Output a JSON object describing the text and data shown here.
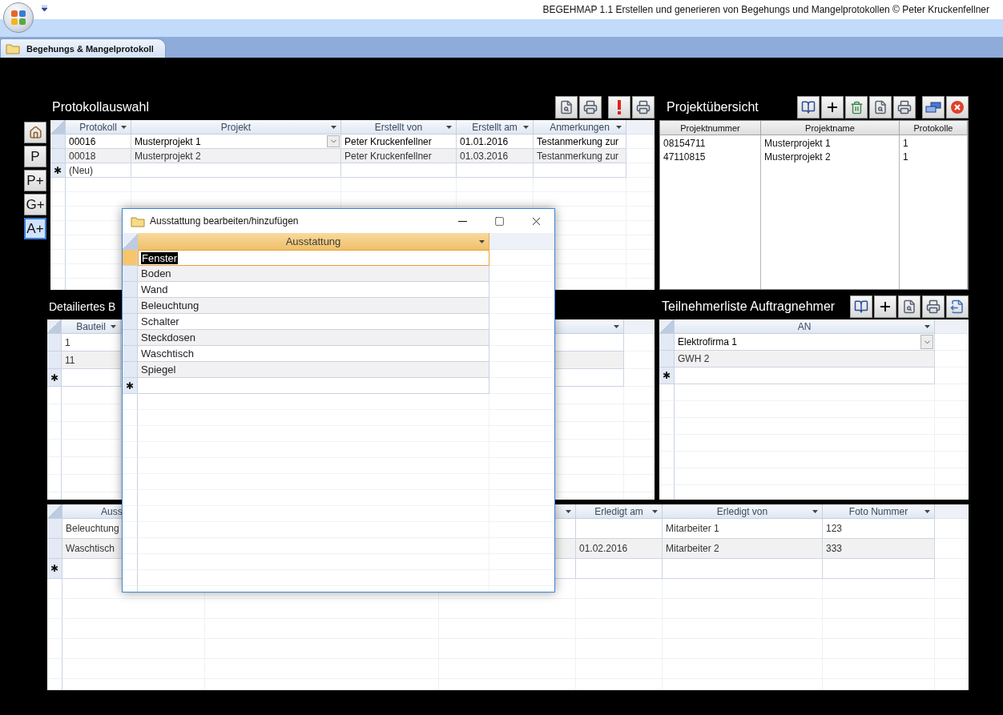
{
  "app": {
    "title": "BEGEHMAP 1.1 Erstellen und generieren von Begehungs und Mangelprotokollen © Peter Kruckenfellner"
  },
  "tabs": [
    {
      "label": "Begehungs & Mangelprotokoll",
      "selected": true
    }
  ],
  "nav_buttons": [
    {
      "kind": "home",
      "selected": false
    },
    {
      "kind": "text",
      "label": "P",
      "selected": false
    },
    {
      "kind": "text",
      "label": "P+",
      "selected": false
    },
    {
      "kind": "text",
      "label": "G+",
      "selected": false
    },
    {
      "kind": "text",
      "label": "A+",
      "selected": true
    }
  ],
  "protocol_panel": {
    "title": "Protokollauswahl",
    "tool_groups": [
      [
        {
          "kind": "preview"
        },
        {
          "kind": "print"
        }
      ],
      [
        {
          "kind": "alert"
        },
        {
          "kind": "print"
        }
      ]
    ],
    "table": {
      "columns": [
        {
          "label": "Protokoll"
        },
        {
          "label": "Projekt",
          "combo": true
        },
        {
          "label": "Erstellt von"
        },
        {
          "label": "Erstellt am"
        },
        {
          "label": "Anmerkungen"
        }
      ],
      "rows": [
        {
          "selected": true,
          "cells": [
            "00016",
            "Musterprojekt 1",
            "Peter Kruckenfellner",
            "01.01.2016",
            "Testanmerkung zur"
          ]
        },
        {
          "selected": false,
          "cells": [
            "00018",
            "Musterprojekt 2",
            "Peter Kruckenfellner",
            "01.03.2016",
            "Testanmerkung zur"
          ]
        }
      ],
      "new_row": {
        "marker": "✱",
        "text": "(Neu)"
      }
    }
  },
  "project_panel": {
    "title": "Projektübersicht",
    "tool_groups": [
      [
        {
          "kind": "book"
        },
        {
          "kind": "add"
        },
        {
          "kind": "recycle"
        },
        {
          "kind": "preview"
        },
        {
          "kind": "print"
        }
      ],
      [
        {
          "kind": "window"
        },
        {
          "kind": "close"
        }
      ]
    ],
    "table": {
      "columns": [
        {
          "label": "Projektnummer"
        },
        {
          "label": "Projektname"
        },
        {
          "label": "Protokolle"
        }
      ],
      "rows": [
        {
          "cells": [
            "08154711",
            "Musterprojekt 1",
            "1"
          ]
        },
        {
          "cells": [
            "47110815",
            "Musterprojekt 2",
            "1"
          ]
        }
      ]
    }
  },
  "detail_panel": {
    "title": "Detailiertes B",
    "table": {
      "columns": [
        {
          "label": "Bauteil"
        },
        {}
      ],
      "rows": [
        {
          "selected": false,
          "cells": [
            "1",
            null
          ]
        },
        {
          "selected": false,
          "cells": [
            "11",
            null
          ]
        }
      ],
      "new_row": {
        "marker": "✱"
      }
    }
  },
  "participants_panel": {
    "title": "Teilnehmerliste Auftragnehmer",
    "tool_groups": [
      [
        {
          "kind": "book"
        },
        {
          "kind": "add"
        },
        {
          "kind": "preview"
        },
        {
          "kind": "print"
        },
        {
          "kind": "export"
        }
      ]
    ],
    "table": {
      "columns": [
        {
          "label": "AN",
          "combo": true
        }
      ],
      "rows": [
        {
          "selected": true,
          "cells": [
            "Elektrofirma 1"
          ]
        },
        {
          "selected": false,
          "cells": [
            "GWH 2"
          ]
        }
      ],
      "new_row": {
        "marker": "✱"
      }
    }
  },
  "defects_table": {
    "columns": [
      {
        "label": "Auss"
      },
      {},
      {},
      {
        "label": "Erledigt am"
      },
      {
        "label": "Erledigt von"
      },
      {
        "label": "Foto Nummer"
      }
    ],
    "rows": [
      {
        "selected": false,
        "cells": [
          "Beleuchtung",
          null,
          null,
          null,
          "Mitarbeiter 1",
          "123"
        ]
      },
      {
        "selected": false,
        "cells": [
          "Waschtisch",
          null,
          null,
          "01.02.2016",
          "Mitarbeiter 2",
          "333"
        ]
      }
    ],
    "new_row": {
      "marker": "✱"
    }
  },
  "dialog": {
    "title": "Ausstattung bearbeiten/hinzufügen",
    "column": "Ausstattung",
    "rows": [
      {
        "value": "Fenster",
        "selected": true
      },
      {
        "value": "Boden",
        "selected": false
      },
      {
        "value": "Wand",
        "selected": false
      },
      {
        "value": "Beleuchtung",
        "selected": false
      },
      {
        "value": "Schalter",
        "selected": false
      },
      {
        "value": "Steckdosen",
        "selected": false
      },
      {
        "value": "Waschtisch",
        "selected": false
      },
      {
        "value": "Spiegel",
        "selected": false
      }
    ],
    "new_row": {
      "marker": "✱"
    }
  }
}
